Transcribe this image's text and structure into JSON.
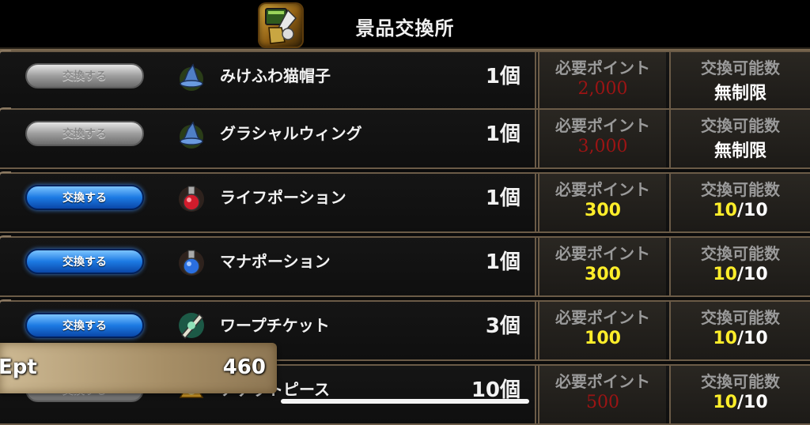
{
  "header": {
    "title": "景品交換所",
    "icon": "shop-emblem-icon"
  },
  "labels": {
    "points_label": "必要ポイント",
    "limit_label": "交換可能数"
  },
  "rows": [
    {
      "button": "交換する",
      "enabled": false,
      "icon": "wizard-hat-icon",
      "name": "みけふわ猫帽子",
      "qty": "1個",
      "points": "2,000",
      "points_color": "red",
      "limit": "無制限",
      "limit_hl": ""
    },
    {
      "button": "交換する",
      "enabled": false,
      "icon": "wizard-hat-icon",
      "name": "グラシャルウィング",
      "qty": "1個",
      "points": "3,000",
      "points_color": "red",
      "limit": "無制限",
      "limit_hl": ""
    },
    {
      "button": "交換する",
      "enabled": true,
      "icon": "red-potion-icon",
      "name": "ライフポーション",
      "qty": "1個",
      "points": "300",
      "points_color": "yellow",
      "limit_hl": "10",
      "limit": "/10"
    },
    {
      "button": "交換する",
      "enabled": true,
      "icon": "blue-potion-icon",
      "name": "マナポーション",
      "qty": "1個",
      "points": "300",
      "points_color": "yellow",
      "limit_hl": "10",
      "limit": "/10"
    },
    {
      "button": "交換する",
      "enabled": true,
      "icon": "warp-ticket-icon",
      "name": "ワープチケット",
      "qty": "3個",
      "points": "100",
      "points_color": "yellow",
      "limit_hl": "10",
      "limit": "/10"
    },
    {
      "button": "交換する",
      "enabled": false,
      "icon": "nugget-piece-icon",
      "name": "ナゲットピース",
      "qty": "10個",
      "points": "500",
      "points_color": "red",
      "limit_hl": "10",
      "limit": "/10"
    }
  ],
  "ept": {
    "label": "Ept",
    "value": "460"
  },
  "colors": {
    "red": "#9c1414",
    "yellow": "#ffee2a",
    "blue_button": "#1c7ae3",
    "frame": "#6b5b47"
  }
}
